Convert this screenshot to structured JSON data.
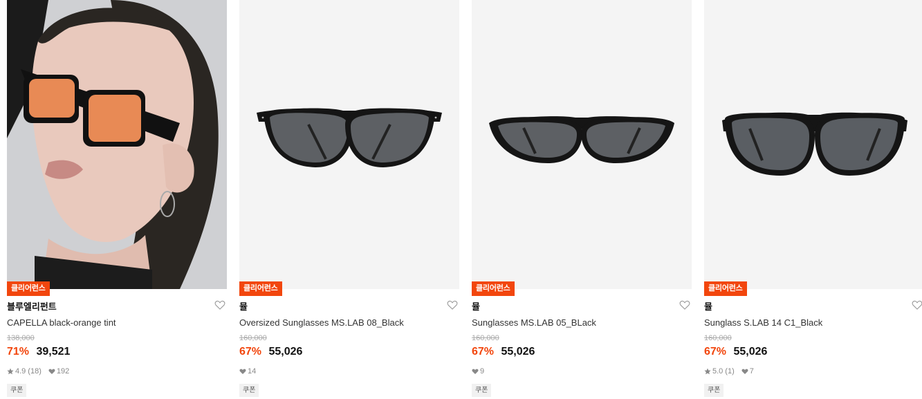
{
  "products": [
    {
      "badge": "클리어런스",
      "brand": "블루엘리펀트",
      "name": "CAPELLA black-orange tint",
      "original_price": "138,000",
      "discount": "71%",
      "price": "39,521",
      "rating": "4.9",
      "review_count": "(18)",
      "likes": "192",
      "coupon": "쿠폰"
    },
    {
      "badge": "클리어런스",
      "brand": "뮬",
      "name": "Oversized Sunglasses MS.LAB 08_Black",
      "original_price": "160,000",
      "discount": "67%",
      "price": "55,026",
      "likes": "14",
      "coupon": "쿠폰"
    },
    {
      "badge": "클리어런스",
      "brand": "뮬",
      "name": "Sunglasses MS.LAB 05_BLack",
      "original_price": "160,000",
      "discount": "67%",
      "price": "55,026",
      "likes": "9",
      "coupon": "쿠폰"
    },
    {
      "badge": "클리어런스",
      "brand": "뮬",
      "name": "Sunglass S.LAB 14 C1_Black",
      "original_price": "160,000",
      "discount": "67%",
      "price": "55,026",
      "rating": "5.0",
      "review_count": "(1)",
      "likes": "7",
      "coupon": "쿠폰"
    }
  ],
  "colors": {
    "accent": "#f2460d",
    "text": "#111111",
    "muted": "#888888",
    "strike": "#aaaaaa"
  },
  "icons": {
    "wishlist": "heart-outline-icon",
    "rating": "star-icon",
    "likes": "heart-icon"
  }
}
